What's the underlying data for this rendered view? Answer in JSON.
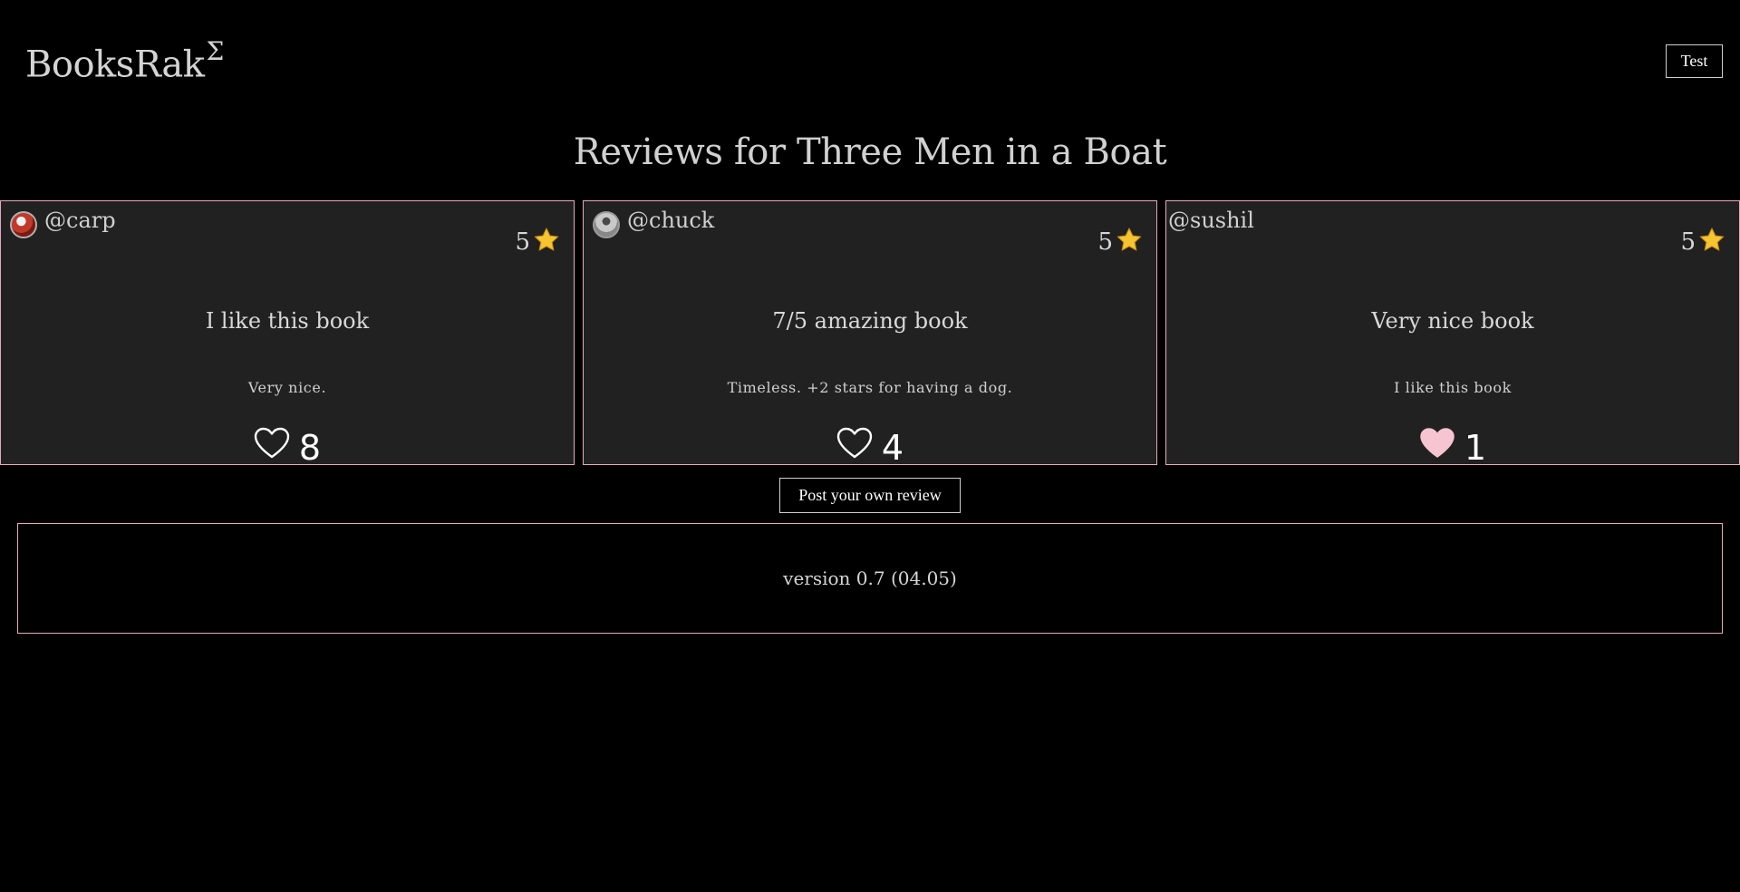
{
  "header": {
    "logo_text": "BooksRak",
    "logo_sup": "Σ",
    "user_button_label": "Test"
  },
  "page_title": "Reviews for Three Men in a Boat",
  "reviews": [
    {
      "username": "@carp",
      "rating": "5",
      "title": "I like this book",
      "body": "Very nice.",
      "likes": "8",
      "liked": false,
      "has_avatar": true
    },
    {
      "username": "@chuck",
      "rating": "5",
      "title": "7/5 amazing book",
      "body": "Timeless. +2 stars for having a dog.",
      "likes": "4",
      "liked": false,
      "has_avatar": true
    },
    {
      "username": "@sushil",
      "rating": "5",
      "title": "Very nice book",
      "body": "I like this book",
      "likes": "1",
      "liked": true,
      "has_avatar": false
    }
  ],
  "post_review_label": "Post your own review",
  "footer": {
    "version": "version 0.7 (04.05)"
  },
  "colors": {
    "background": "#000000",
    "card_background": "#212121",
    "card_border": "#e8a9be",
    "liked_heart": "#f7c4d2",
    "star": "#f5c431"
  },
  "icons": {
    "rating": "star-icon",
    "like_empty": "heart-outline-icon",
    "like_filled": "heart-filled-icon"
  }
}
